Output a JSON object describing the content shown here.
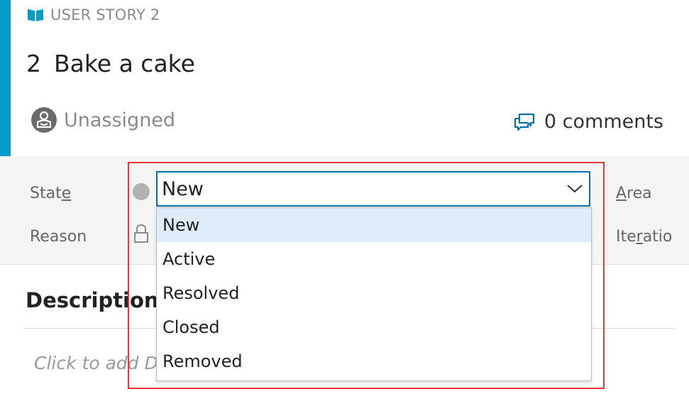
{
  "work_item": {
    "type_label": "USER STORY 2",
    "id": "2",
    "title": "Bake a cake",
    "assigned_to": "Unassigned",
    "comments": "0 comments"
  },
  "fields": {
    "state_label": {
      "before": "Stat",
      "underline": "e",
      "after": ""
    },
    "reason_label": "Reason",
    "area_label": {
      "before": "",
      "underline": "A",
      "after": "rea"
    },
    "iteration_label": {
      "before": "Ite",
      "underline": "r",
      "after": "atio"
    }
  },
  "state_dropdown": {
    "selected_value": "New",
    "options": [
      "New",
      "Active",
      "Resolved",
      "Closed",
      "Removed"
    ],
    "highlighted_option": "New"
  },
  "description": {
    "title": "Description",
    "placeholder": "Click to add D"
  },
  "colors": {
    "accent": "#009ccc",
    "focus_border": "#0a6fa8",
    "option_highlight": "#deecf9",
    "annotation_box": "#e0383b",
    "state_dot": "#b2b2b2"
  },
  "icons": {
    "type_icon": "book-icon",
    "assignee": "user-avatar-icon",
    "comments": "comments-icon",
    "dropdown": "chevron-down-icon",
    "reason": "lock-icon"
  }
}
